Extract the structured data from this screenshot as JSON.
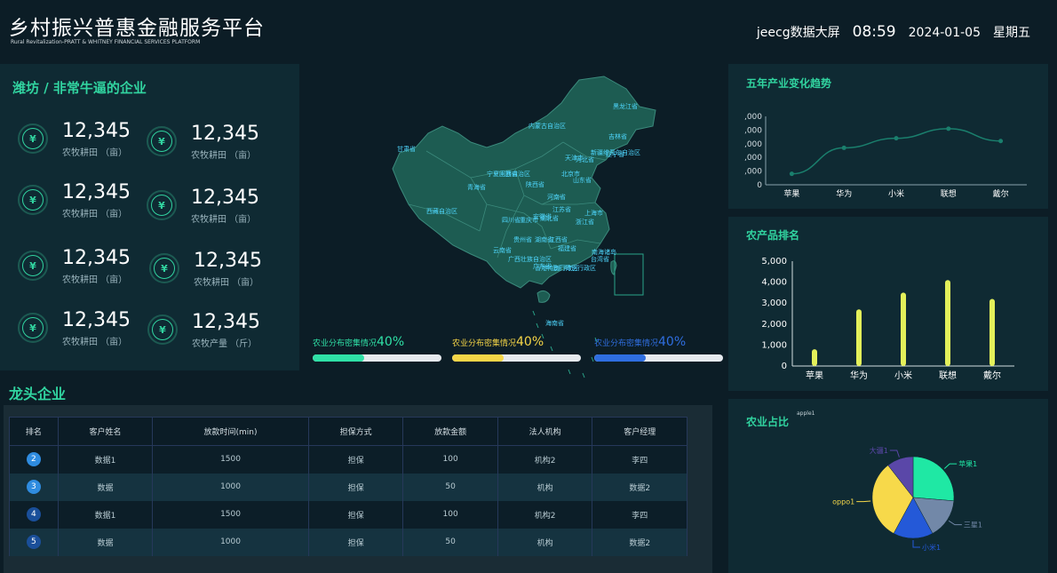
{
  "header": {
    "title": "乡村振兴普惠金融服务平台",
    "subtitle": "Rural Revitalization-PRATT & WHITNEY FINANCIAL SERVICES PLATFORM",
    "brand": "jeecg数据大屏",
    "time": "08:59",
    "date": "2024-01-05",
    "weekday": "星期五"
  },
  "stats_panel": {
    "title": "潍坊 / 非常牛逼的企业",
    "icon": "coin-stack-icon",
    "items": [
      {
        "value": "12,345",
        "label": "农牧耕田 （亩）"
      },
      {
        "value": "12,345",
        "label": "农牧耕田 （亩）"
      },
      {
        "value": "12,345",
        "label": "农牧耕田 （亩）"
      },
      {
        "value": "12,345",
        "label": "农牧耕田 （亩）"
      },
      {
        "value": "12,345",
        "label": "农牧耕田 （亩）"
      },
      {
        "value": "12,345",
        "label": "农牧耕田 （亩）"
      },
      {
        "value": "12,345",
        "label": "农牧耕田 （亩）"
      },
      {
        "value": "12,345",
        "label": "农牧产量 （斤）"
      }
    ]
  },
  "map": {
    "provinces": [
      "黑龙江省",
      "内蒙古自治区",
      "吉林省",
      "辽宁省",
      "新疆维吾尔自治区",
      "甘肃省",
      "宁夏回族自治区",
      "山西省",
      "北京市",
      "天津市",
      "河北省",
      "山东省",
      "青海省",
      "陕西省",
      "河南省",
      "江苏省",
      "安徽省",
      "上海市",
      "湖北省",
      "四川省",
      "重庆市",
      "浙江省",
      "西藏自治区",
      "贵州省",
      "湖南省",
      "江西省",
      "福建省",
      "云南省",
      "广西壮族自治区",
      "广东省",
      "台湾省",
      "香港特别行政区",
      "澳门特别行政区",
      "海南省",
      "南海诸岛"
    ],
    "fill": "#1d5c52",
    "label_color": "#4fd8ff"
  },
  "progress": [
    {
      "label": "农业分布密集情况",
      "percent": "40%",
      "fraction": 0.4,
      "color": "#2fe0a6"
    },
    {
      "label": "农业分布密集情况",
      "percent": "40%",
      "fraction": 0.4,
      "color": "#f5d547"
    },
    {
      "label": "农业分布密集情况",
      "percent": "40%",
      "fraction": 0.4,
      "color": "#2f6ee0"
    }
  ],
  "leaders": {
    "title": "龙头企业",
    "columns": [
      "排名",
      "客户姓名",
      "放款时间(min)",
      "担保方式",
      "放款金额",
      "法人机构",
      "客户经理"
    ],
    "rows": [
      {
        "rank": "2",
        "name": "数据1",
        "time": "1500",
        "guarantee": "担保",
        "amount": "100",
        "org": "机构2",
        "manager": "李四",
        "badge": "#2f8ce0"
      },
      {
        "rank": "3",
        "name": "数据",
        "time": "1000",
        "guarantee": "担保",
        "amount": "50",
        "org": "机构",
        "manager": "数据2",
        "badge": "#2f8ce0"
      },
      {
        "rank": "4",
        "name": "数据1",
        "time": "1500",
        "guarantee": "担保",
        "amount": "100",
        "org": "机构2",
        "manager": "李四",
        "badge": "#1a4f9a"
      },
      {
        "rank": "5",
        "name": "数据",
        "time": "1000",
        "guarantee": "担保",
        "amount": "50",
        "org": "机构",
        "manager": "数据2",
        "badge": "#1a4f9a"
      }
    ]
  },
  "trend": {
    "title": "五年产业变化趋势",
    "chart_data": {
      "type": "line",
      "categories": [
        "苹果",
        "华为",
        "小米",
        "联想",
        "戴尔"
      ],
      "values": [
        800,
        2700,
        3400,
        4100,
        3200
      ],
      "ylim": [
        0,
        5000
      ],
      "ytick_labels": [
        ",000",
        ",000",
        ",000",
        ",000",
        ",000"
      ],
      "y0_label": "0",
      "color": "#1a7f6d"
    }
  },
  "ranking": {
    "title": "农产品排名",
    "chart_data": {
      "type": "bar",
      "categories": [
        "苹果",
        "华为",
        "小米",
        "联想",
        "戴尔"
      ],
      "values": [
        800,
        2700,
        3500,
        4100,
        3200
      ],
      "ylim": [
        0,
        5000
      ],
      "yticks": [
        "0",
        "1,000",
        "2,000",
        "3,000",
        "4,000",
        "5,000"
      ],
      "color": "#e3f05a"
    }
  },
  "share": {
    "title": "农业占比",
    "overlay_text": "apple1",
    "chart_data": {
      "type": "pie",
      "slices": [
        {
          "name": "苹果1",
          "value": 25,
          "color": "#1fe8a4"
        },
        {
          "name": "三星1",
          "value": 15,
          "color": "#7288a8"
        },
        {
          "name": "小米1",
          "value": 15,
          "color": "#2459d8"
        },
        {
          "name": "oppo1",
          "value": 30,
          "color": "#f7d94a"
        },
        {
          "name": "大疆1",
          "value": 10,
          "color": "#5a47a8"
        }
      ]
    }
  }
}
